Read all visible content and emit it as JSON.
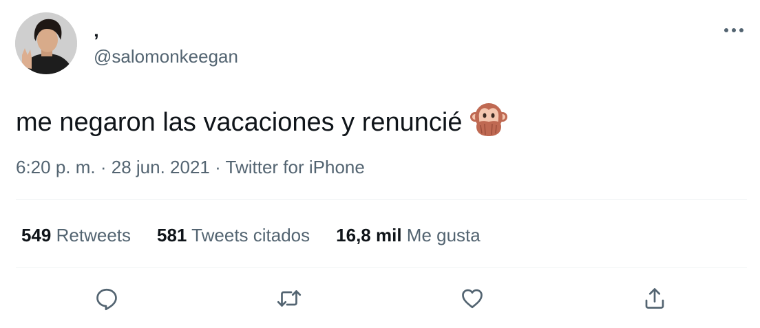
{
  "author": {
    "display_name": "‚",
    "handle": "@salomonkeegan"
  },
  "tweet": {
    "text": "me negaron las vacaciones y renuncié",
    "emoji": "speak-no-evil-monkey"
  },
  "meta": {
    "time": "6:20 p. m.",
    "separator1": " · ",
    "date": "28 jun. 2021",
    "separator2": " · ",
    "source": "Twitter for iPhone"
  },
  "stats": {
    "retweets": {
      "count": "549",
      "label": "Retweets"
    },
    "quotes": {
      "count": "581",
      "label": "Tweets citados"
    },
    "likes": {
      "count": "16,8 mil",
      "label": "Me gusta"
    }
  },
  "actions": {
    "reply": "reply-icon",
    "retweet": "retweet-icon",
    "like": "heart-icon",
    "share": "share-icon"
  },
  "colors": {
    "text": "#0f1419",
    "secondary": "#536471",
    "divider": "#eff3f4"
  }
}
